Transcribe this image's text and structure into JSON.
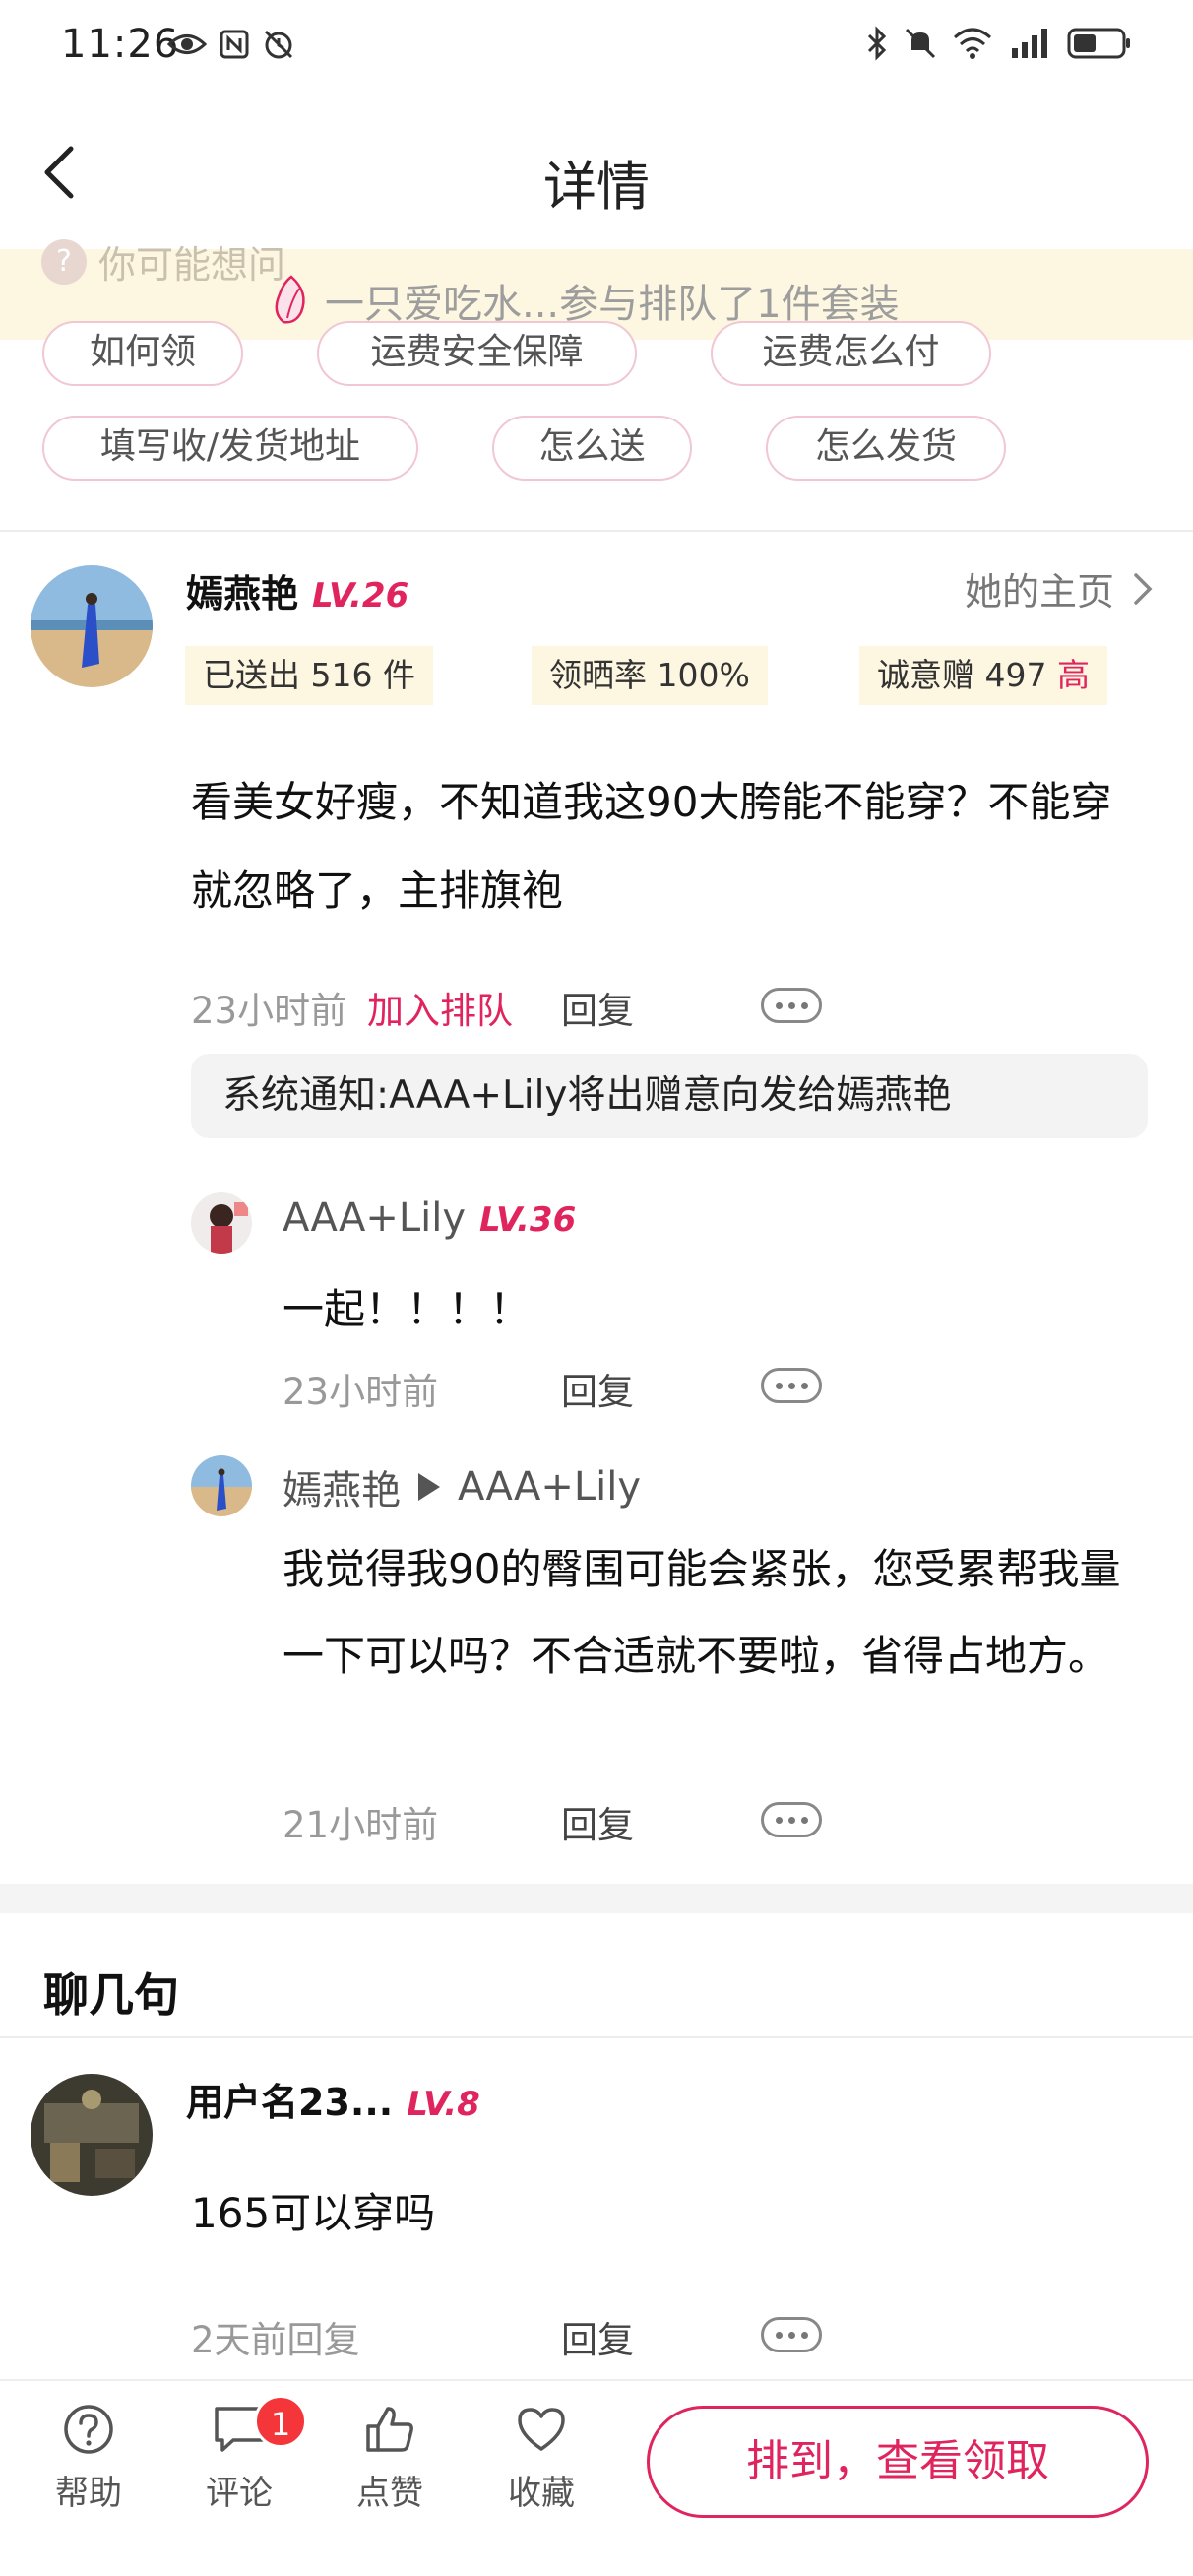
{
  "status_bar": {
    "time": "11:26"
  },
  "nav": {
    "title": "详情"
  },
  "banner": {
    "faded_text": "你可能想问",
    "text": "一只爱吃水...参与排队了1件套装"
  },
  "chips": [
    "如何领",
    "运费安全保障",
    "运费怎么付",
    "填写收/发货地址",
    "怎么送",
    "怎么发货"
  ],
  "post": {
    "username": "嫣燕艳",
    "level": "LV.26",
    "homepage_link": "她的主页",
    "stats": {
      "sent": "已送出 516 件",
      "review_rate": "领晒率 100%",
      "sincerity_label": "诚意赠 497",
      "sincerity_level": "高"
    },
    "text": "看美女好瘦，不知道我这90大胯能不能穿？不能穿就忽略了，主排旗袍",
    "time": "23小时前",
    "join_queue": "加入排队",
    "reply": "回复",
    "system_notice": "系统通知:AAA+Lily将出赠意向发给嫣燕艳"
  },
  "replies": [
    {
      "username": "AAA+Lily",
      "level": "LV.36",
      "text": "一起！！！！",
      "time": "23小时前",
      "reply": "回复"
    },
    {
      "username": "嫣燕艳",
      "reply_to": "AAA+Lily",
      "text": "我觉得我90的臀围可能会紧张，您受累帮我量一下可以吗？不合适就不要啦，省得占地方。",
      "time": "21小时前",
      "reply": "回复"
    }
  ],
  "chat_section": {
    "title": "聊几句",
    "comment": {
      "username": "用户名23...",
      "level": "LV.8",
      "text": "165可以穿吗",
      "time": "2天前回复",
      "reply": "回复"
    }
  },
  "bottom_bar": {
    "help": "帮助",
    "comment": "评论",
    "comment_badge": "1",
    "like": "点赞",
    "favorite": "收藏",
    "cta": "排到，查看领取"
  },
  "colors": {
    "accent": "#e0245e",
    "banner_bg": "#fdf6e0",
    "badge": "#f4363a"
  }
}
